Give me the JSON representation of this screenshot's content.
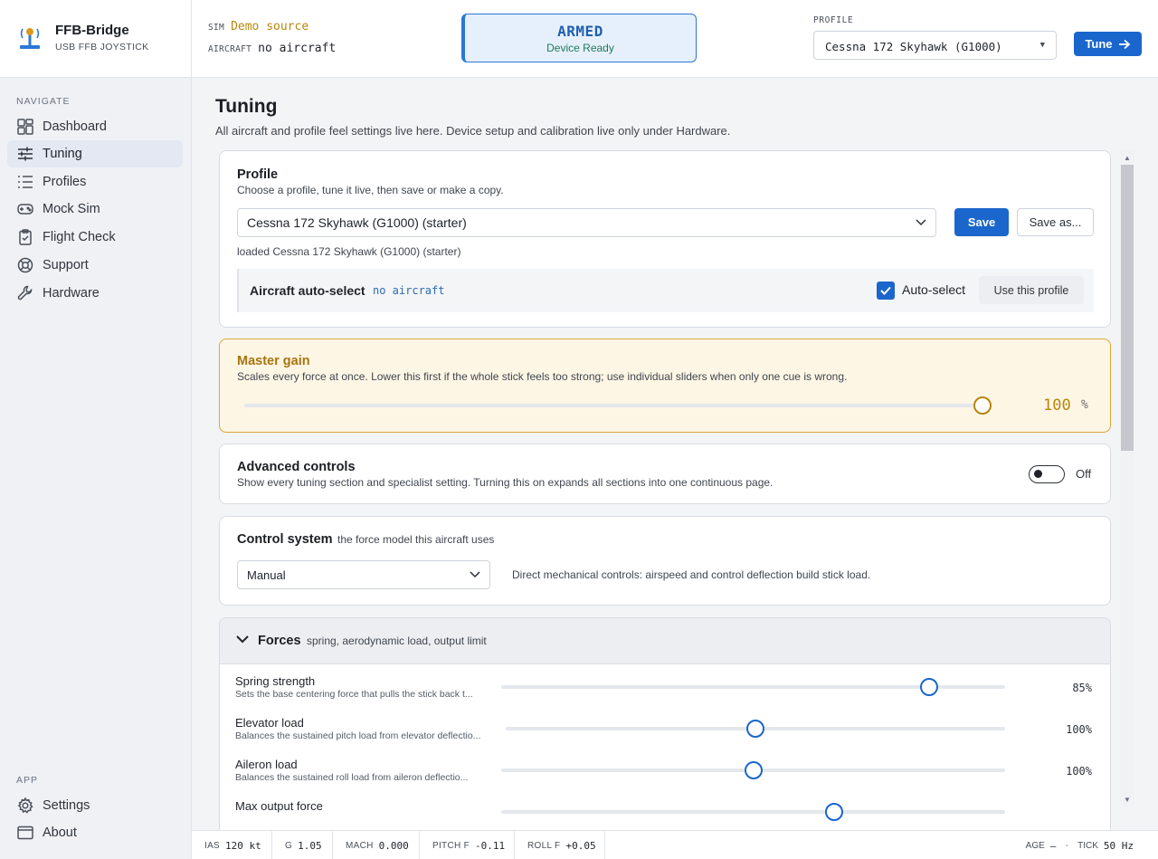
{
  "brand": {
    "name": "FFB-Bridge",
    "subtitle": "USB FFB JOYSTICK"
  },
  "sidebar": {
    "navigate_label": "NAVIGATE",
    "items": [
      {
        "label": "Dashboard",
        "icon": "dashboard-icon"
      },
      {
        "label": "Tuning",
        "icon": "sliders-icon",
        "active": true
      },
      {
        "label": "Profiles",
        "icon": "list-icon"
      },
      {
        "label": "Mock Sim",
        "icon": "gamepad-icon"
      },
      {
        "label": "Flight Check",
        "icon": "clipboard-check-icon"
      },
      {
        "label": "Support",
        "icon": "lifebuoy-icon"
      },
      {
        "label": "Hardware",
        "icon": "wrench-icon"
      }
    ],
    "app_label": "APP",
    "app_items": [
      {
        "label": "Settings",
        "icon": "gear-icon"
      },
      {
        "label": "About",
        "icon": "window-icon"
      }
    ]
  },
  "header": {
    "sim_key": "SIM",
    "sim_value": "Demo source",
    "aircraft_key": "AIRCRAFT",
    "aircraft_value": "no aircraft",
    "status_title": "ARMED",
    "status_sub": "Device Ready",
    "profile_label": "PROFILE",
    "profile_value": "Cessna 172 Skyhawk (G1000)",
    "tune_label": "Tune"
  },
  "page": {
    "title": "Tuning",
    "subtitle": "All aircraft and profile feel settings live here. Device setup and calibration live only under Hardware."
  },
  "profile_card": {
    "title": "Profile",
    "subtitle": "Choose a profile, tune it live, then save or make a copy.",
    "selected": "Cessna 172 Skyhawk (G1000) (starter)",
    "save_label": "Save",
    "save_as_label": "Save as...",
    "loaded_text": "loaded Cessna 172 Skyhawk (G1000) (starter)",
    "autoselect_title": "Aircraft auto-select",
    "autoselect_value": "no aircraft",
    "autoselect_checkbox_label": "Auto-select",
    "autoselect_checked": true,
    "use_profile_label": "Use this profile"
  },
  "master_gain": {
    "title": "Master gain",
    "subtitle": "Scales every force at once. Lower this first if the whole stick feels too strong; use individual sliders when only one cue is wrong.",
    "value": "100",
    "unit": "%",
    "fraction": 1.0,
    "accent": "#b8860b"
  },
  "advanced": {
    "title": "Advanced controls",
    "subtitle": "Show every tuning section and specialist setting. Turning this on expands all sections into one continuous page.",
    "state_label": "Off",
    "enabled": false
  },
  "control_system": {
    "title": "Control system",
    "hint": "the force model this aircraft uses",
    "selected": "Manual",
    "description": "Direct mechanical controls: airspeed and control deflection build stick load."
  },
  "forces": {
    "title": "Forces",
    "hint": "spring, aerodynamic load, output limit",
    "rows": [
      {
        "name": "Spring strength",
        "desc": "Sets the base centering force that pulls the stick back t...",
        "value": "85%",
        "fraction": 0.85
      },
      {
        "name": "Elevator load",
        "desc": "Balances the sustained pitch load from elevator deflectio...",
        "value": "100%",
        "fraction": 0.5
      },
      {
        "name": "Aileron load",
        "desc": "Balances the sustained roll load from aileron deflectio...",
        "value": "100%",
        "fraction": 0.5
      },
      {
        "name": "Max output force",
        "desc": "",
        "value": "",
        "fraction": 0.66
      }
    ]
  },
  "statusbar": {
    "cells": [
      {
        "key": "IAS",
        "value": "120 kt"
      },
      {
        "key": "G",
        "value": "1.05"
      },
      {
        "key": "MACH",
        "value": "0.000"
      },
      {
        "key": "PITCH F",
        "value": "-0.11"
      },
      {
        "key": "ROLL F",
        "value": "+0.05"
      }
    ],
    "age_key": "AGE",
    "age_value": "—",
    "dot": "·",
    "tick_key": "TICK",
    "tick_value": "50 Hz"
  },
  "colors": {
    "accent": "#1a66cc",
    "gain": "#b8860b",
    "armed": "#2a78d4",
    "ready": "#1e7a5a"
  }
}
